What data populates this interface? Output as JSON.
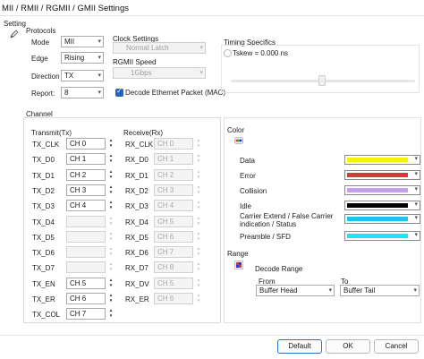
{
  "window": {
    "title": "MII / RMII / RGMII / GMII Settings",
    "setting_label": "Setting"
  },
  "protocols": {
    "group_label": "Protocols",
    "mode": {
      "label": "Mode",
      "value": "MII"
    },
    "edge": {
      "label": "Edge",
      "value": "Rising"
    },
    "direction": {
      "label": "Direction",
      "value": "TX"
    },
    "report": {
      "label": "Report:",
      "value": "8"
    }
  },
  "clock": {
    "label": "Clock Settings",
    "value": "Normal Latch",
    "rgmii_label": "RGMII Speed",
    "rgmii_value": "1Gbps",
    "decode_label": "Decode Ethernet Packet (MAC)",
    "decode_checked": true
  },
  "timing": {
    "label": "Timing Specifics",
    "tskew_label": "Tskew = 0.000 ns"
  },
  "channel": {
    "group_label": "Channel",
    "transmit_label": "Transmit(Tx)",
    "receive_label": "Receive(Rx)",
    "tx": [
      {
        "name": "TX_CLK",
        "value": "CH 0",
        "enabled": true
      },
      {
        "name": "TX_D0",
        "value": "CH 1",
        "enabled": true
      },
      {
        "name": "TX_D1",
        "value": "CH 2",
        "enabled": true
      },
      {
        "name": "TX_D2",
        "value": "CH 3",
        "enabled": true
      },
      {
        "name": "TX_D3",
        "value": "CH 4",
        "enabled": true
      },
      {
        "name": "TX_D4",
        "value": "",
        "enabled": false
      },
      {
        "name": "TX_D5",
        "value": "",
        "enabled": false
      },
      {
        "name": "TX_D6",
        "value": "",
        "enabled": false
      },
      {
        "name": "TX_D7",
        "value": "",
        "enabled": false
      },
      {
        "name": "TX_EN",
        "value": "CH 5",
        "enabled": true
      },
      {
        "name": "TX_ER",
        "value": "CH 6",
        "enabled": true
      },
      {
        "name": "TX_COL",
        "value": "CH 7",
        "enabled": true
      }
    ],
    "rx": [
      {
        "name": "RX_CLK",
        "value": "CH 0"
      },
      {
        "name": "RX_D0",
        "value": "CH 1"
      },
      {
        "name": "RX_D1",
        "value": "CH 2"
      },
      {
        "name": "RX_D2",
        "value": "CH 3"
      },
      {
        "name": "RX_D3",
        "value": "CH 4"
      },
      {
        "name": "RX_D4",
        "value": "CH 5"
      },
      {
        "name": "RX_D5",
        "value": "CH 6"
      },
      {
        "name": "RX_D6",
        "value": "CH 7"
      },
      {
        "name": "RX_D7",
        "value": "CH 8"
      },
      {
        "name": "RX_DV",
        "value": "CH 5"
      },
      {
        "name": "RX_ER",
        "value": "CH 6"
      }
    ]
  },
  "color": {
    "label": "Color",
    "items": [
      {
        "label": "Data",
        "color": "#f4f400"
      },
      {
        "label": "Error",
        "color": "#d83a3a"
      },
      {
        "label": "Collision",
        "color": "#c6a0ee"
      },
      {
        "label": "Idle",
        "color": "#000000"
      },
      {
        "label": "Carrier Extend / False Carrier indication / Status",
        "color": "#1cc4f2"
      },
      {
        "label": "Preamble / SFD",
        "color": "#19e6f0"
      }
    ]
  },
  "range": {
    "label": "Range",
    "decode_range_label": "Decode Range",
    "from_label": "From",
    "from_value": "Buffer Head",
    "to_label": "To",
    "to_value": "Buffer Tail"
  },
  "buttons": {
    "default": "Default",
    "ok": "OK",
    "cancel": "Cancel"
  }
}
